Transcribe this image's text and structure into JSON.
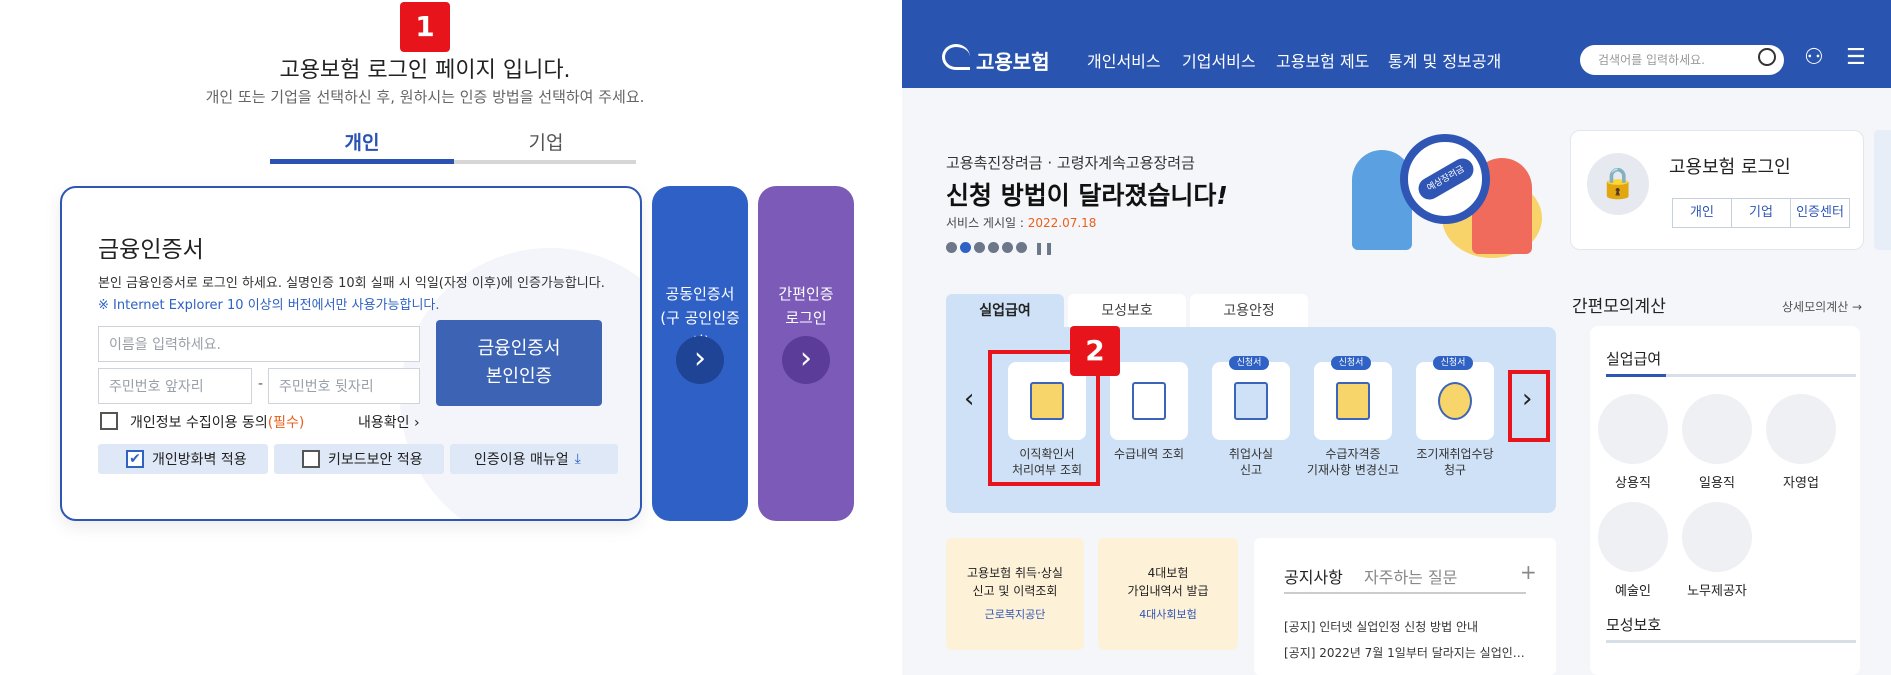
{
  "markers": {
    "one": "1",
    "two": "2"
  },
  "login_page": {
    "title": "고용보험 로그인 페이지 입니다.",
    "subtitle": "개인 또는 기업을 선택하신 후, 원하시는 인증 방법을 선택하여 주세요.",
    "tabs": [
      {
        "label": "개인",
        "active": true
      },
      {
        "label": "기업",
        "active": false
      }
    ],
    "cert_card": {
      "title": "금융인증서",
      "description": "본인 금융인증서로 로그인 하세요. 실명인증 10회 실패 시 익일(자정 이후)에 인증가능합니다.",
      "note": "※ Internet Explorer 10 이상의 버전에서만 사용가능합니다.",
      "name_placeholder": "이름을 입력하세요.",
      "rrn_front_placeholder": "주민번호 앞자리",
      "rrn_separator": "-",
      "rrn_back_placeholder": "주민번호 뒷자리",
      "auth_button_line1": "금융인증서",
      "auth_button_line2": "본인인증",
      "consent_label": "개인정보 수집이용 동의",
      "consent_required": "(필수)",
      "consent_link": "내용확인",
      "options": [
        {
          "label": "개인방화벽 적용",
          "checked": true
        },
        {
          "label": "키보드보안 적용",
          "checked": false
        }
      ],
      "manual_label": "인증이용 매뉴얼"
    },
    "side_buttons": [
      {
        "line1": "공동인증서",
        "line2": "(구 공인인증서)",
        "color": "#2f60c6"
      },
      {
        "line1": "간편인증",
        "line2": "로그인",
        "color": "#7c5bb8"
      }
    ]
  },
  "portal": {
    "logo": "고용보험",
    "nav": [
      "개인서비스",
      "기업서비스",
      "고용보험 제도",
      "통계 및 정보공개"
    ],
    "search_placeholder": "검색어를 입력하세요.",
    "banner": {
      "kicker": "고용촉진장려금 · 고령자계속고용장려금",
      "headline": "신청 방법이 달라졌습니다",
      "headline_mark": "!",
      "date_label": "서비스 게시일 : ",
      "date_value": "2022.07.18",
      "illustration_sign": "예상장려금"
    },
    "service_tabs": [
      "실업급여",
      "모성보호",
      "고용안정"
    ],
    "services": [
      {
        "line1": "이직확인서",
        "line2": "처리여부 조회",
        "badge": ""
      },
      {
        "line1": "수급내역 조회",
        "line2": "",
        "badge": ""
      },
      {
        "line1": "취업사실",
        "line2": "신고",
        "badge": "신청서"
      },
      {
        "line1": "수급자격증",
        "line2": "기재사항 변경신고",
        "badge": "신청서"
      },
      {
        "line1": "조기재취업수당",
        "line2": "청구",
        "badge": "신청서"
      }
    ],
    "quick_cards": [
      {
        "line1": "고용보험 취득·상실",
        "line2": "신고 및 이력조회",
        "org": "근로복지공단"
      },
      {
        "line1": "4대보험",
        "line2": "가입내역서 발급",
        "org": "4대사회보험"
      }
    ],
    "notice": {
      "tabs": [
        "공지사항",
        "자주하는 질문"
      ],
      "more": "+",
      "items": [
        "[공지] 인터넷 실업인정 신청 방법 안내",
        "[공지] 2022년 7월 1일부터 달라지는 실업인…"
      ]
    },
    "login_box": {
      "title": "고용보험 로그인",
      "buttons": [
        "개인",
        "기업",
        "인증센터"
      ]
    },
    "calc": {
      "title": "간편모의계산",
      "link": "상세모의계산 →",
      "section1": "실업급여",
      "items": [
        "상용직",
        "일용직",
        "자영업",
        "예술인",
        "노무제공자"
      ],
      "section2": "모성보호"
    }
  },
  "colors": {
    "accent": "#2955b0",
    "marker": "#e8141b",
    "purple": "#7c5bb8",
    "date": "#e8601c"
  }
}
